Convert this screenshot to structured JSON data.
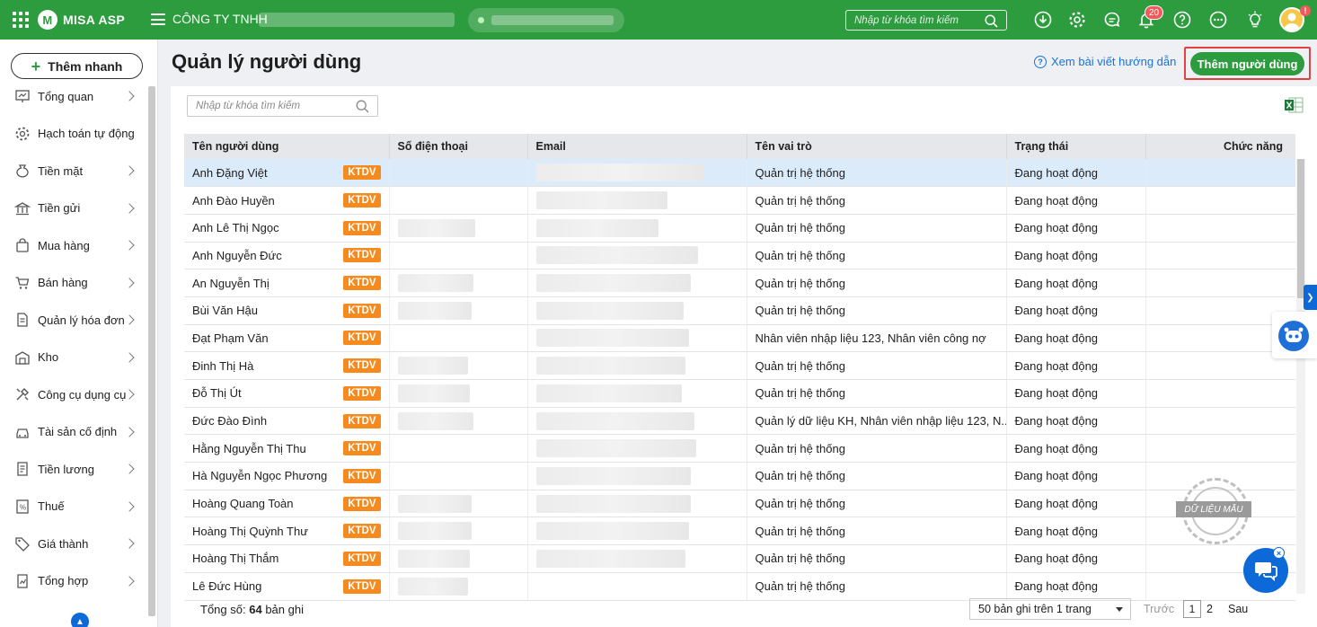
{
  "app": {
    "name": "MISA ASP",
    "company": "CÔNG TY TNHH"
  },
  "top_search": {
    "placeholder": "Nhập từ khóa tìm kiếm"
  },
  "notifications": {
    "count": "20"
  },
  "avatar_badge": "!",
  "sidebar": {
    "quick_add": "Thêm nhanh",
    "items": [
      {
        "label": "Tổng quan",
        "icon": "dashboard-icon",
        "chevron": true
      },
      {
        "label": "Hạch toán tự động",
        "icon": "gear-icon",
        "chevron": false
      },
      {
        "label": "Tiền mặt",
        "icon": "money-bag-icon",
        "chevron": true
      },
      {
        "label": "Tiền gửi",
        "icon": "bank-icon",
        "chevron": true
      },
      {
        "label": "Mua hàng",
        "icon": "shopping-bag-icon",
        "chevron": true
      },
      {
        "label": "Bán hàng",
        "icon": "cart-icon",
        "chevron": true
      },
      {
        "label": "Quản lý hóa đơn",
        "icon": "invoice-icon",
        "chevron": true
      },
      {
        "label": "Kho",
        "icon": "warehouse-icon",
        "chevron": true
      },
      {
        "label": "Công cụ dụng cụ",
        "icon": "tools-icon",
        "chevron": true
      },
      {
        "label": "Tài sản cố định",
        "icon": "car-icon",
        "chevron": true
      },
      {
        "label": "Tiền lương",
        "icon": "payroll-icon",
        "chevron": true
      },
      {
        "label": "Thuế",
        "icon": "tax-icon",
        "chevron": true
      },
      {
        "label": "Giá thành",
        "icon": "price-tag-icon",
        "chevron": true
      },
      {
        "label": "Tổng hợp",
        "icon": "report-icon",
        "chevron": true
      }
    ]
  },
  "page": {
    "title": "Quản lý người dùng",
    "help_link": "Xem bài viết hướng dẫn",
    "add_user": "Thêm người dùng",
    "filter_placeholder": "Nhập từ khóa tìm kiếm"
  },
  "table": {
    "columns": [
      "Tên người dùng",
      "Số điện thoại",
      "Email",
      "Tên vai trò",
      "Trạng thái",
      "Chức năng"
    ],
    "badge": "KTDV",
    "rows": [
      {
        "name": "Anh Đặng Việt",
        "role": "Quản trị hệ thống",
        "status": "Đang hoạt động",
        "phone": false,
        "email": true,
        "selected": true
      },
      {
        "name": "Anh Đào Huyền",
        "role": "Quản trị hệ thống",
        "status": "Đang hoạt động",
        "phone": false,
        "email": true
      },
      {
        "name": "Anh Lê Thị Ngọc",
        "role": "Quản trị hệ thống",
        "status": "Đang hoạt động",
        "phone": true,
        "email": true
      },
      {
        "name": "Anh Nguyễn Đức",
        "role": "Quản trị hệ thống",
        "status": "Đang hoạt động",
        "phone": false,
        "email": true
      },
      {
        "name": "An Nguyễn Thị",
        "role": "Quản trị hệ thống",
        "status": "Đang hoạt động",
        "phone": true,
        "email": true
      },
      {
        "name": "Bùi Văn Hậu",
        "role": "Quản trị hệ thống",
        "status": "Đang hoạt động",
        "phone": true,
        "email": true
      },
      {
        "name": "Đạt Phạm Văn",
        "role": "Nhân viên nhập liệu 123, Nhân viên công nợ",
        "status": "Đang hoạt động",
        "phone": false,
        "email": true
      },
      {
        "name": "Đinh Thị Hà",
        "role": "Quản trị hệ thống",
        "status": "Đang hoạt động",
        "phone": true,
        "email": true
      },
      {
        "name": "Đỗ Thị Út",
        "role": "Quản trị hệ thống",
        "status": "Đang hoạt động",
        "phone": true,
        "email": true
      },
      {
        "name": "Đức Đào Đình",
        "role": "Quản lý dữ liệu KH, Nhân viên nhập liệu 123, N...",
        "status": "Đang hoạt động",
        "phone": true,
        "email": true
      },
      {
        "name": "Hằng Nguyễn Thị Thu",
        "role": "Quản trị hệ thống",
        "status": "Đang hoạt động",
        "phone": false,
        "email": true
      },
      {
        "name": "Hà Nguyễn Ngọc Phương",
        "role": "Quản trị hệ thống",
        "status": "Đang hoạt động",
        "phone": false,
        "email": true
      },
      {
        "name": "Hoàng Quang Toàn",
        "role": "Quản trị hệ thống",
        "status": "Đang hoạt động",
        "phone": true,
        "email": true
      },
      {
        "name": "Hoàng Thị Quỳnh Thư",
        "role": "Quản trị hệ thống",
        "status": "Đang hoạt động",
        "phone": true,
        "email": true
      },
      {
        "name": "Hoàng Thị Thắm",
        "role": "Quản trị hệ thống",
        "status": "Đang hoạt động",
        "phone": true,
        "email": true
      },
      {
        "name": "Lê Đức Hùng",
        "role": "Quản trị hệ thống",
        "status": "Đang hoạt động",
        "phone": true,
        "email": false
      }
    ]
  },
  "footer": {
    "total_prefix": "Tổng số:",
    "total_count": "64",
    "total_suffix": "bản ghi",
    "page_size": "50 bản ghi trên 1 trang",
    "prev": "Trước",
    "pages": [
      "1",
      "2"
    ],
    "current_page": "1",
    "next": "Sau"
  },
  "watermark": "DỮ LIỆU MẪU"
}
